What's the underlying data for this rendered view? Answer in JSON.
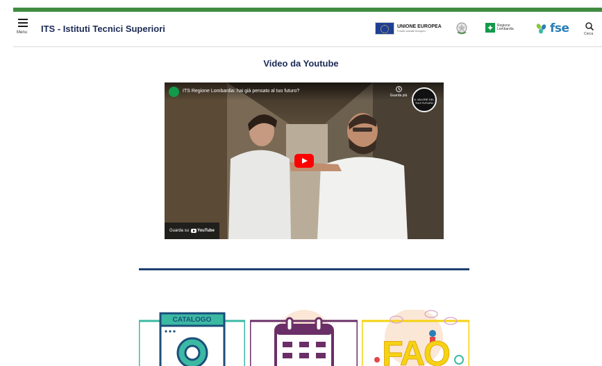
{
  "header": {
    "menu_label": "Menu",
    "site_title": "ITS - Istituti Tecnici Superiori",
    "eu_title": "UNIONE EUROPEA",
    "eu_subtitle": "Fondo sociale europeo",
    "regione_line1": "Regione",
    "regione_line2": "Lombardia",
    "fse_label": "fse",
    "search_label": "Cerca"
  },
  "main": {
    "section_title": "Video da Youtube",
    "video": {
      "title": "ITS Regione Lombardia: hai già pensato al tuo futuro?",
      "watch_later": "Guarda più",
      "channel_badge": "IL VALORE DEL TUO FUTURO",
      "watch_on": "Guarda su",
      "youtube": "YouTube"
    },
    "cards": [
      {
        "label": "CATALOGO"
      },
      {
        "label": ""
      },
      {
        "label": "FAQ"
      }
    ]
  },
  "colors": {
    "accent_green": "#3f8b41",
    "title_navy": "#1b2a55",
    "divider_blue": "#1b3f6e",
    "youtube_red": "#ff0000",
    "card_teal": "#3bb9a3",
    "card_purple": "#6b2f67",
    "card_yellow": "#f5d312"
  }
}
